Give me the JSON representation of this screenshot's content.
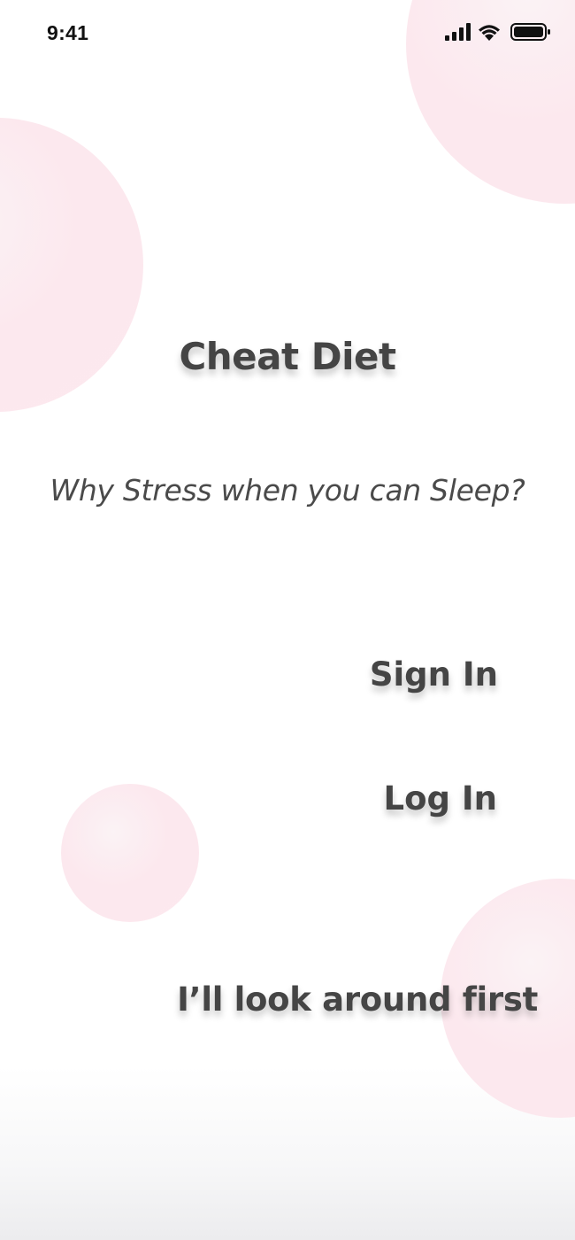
{
  "status_bar": {
    "time": "9:41",
    "icons": [
      "signal-icon",
      "wifi-icon",
      "battery-icon"
    ]
  },
  "app": {
    "title": "Cheat Diet",
    "tagline": "Why Stress when you can Sleep?"
  },
  "actions": {
    "sign_in_label": "Sign In",
    "log_in_label": "Log In",
    "look_around_label": "I’ll look around first"
  },
  "colors": {
    "text": "#454545",
    "bubble": "#fde9ef",
    "background": "#ffffff"
  }
}
